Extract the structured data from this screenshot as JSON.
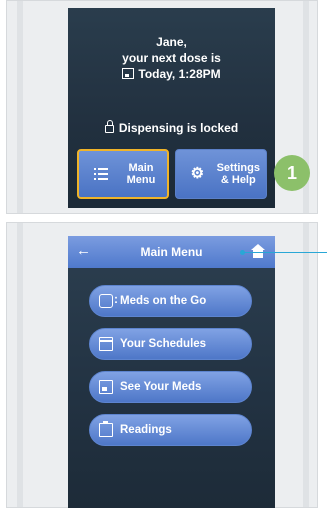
{
  "step1": {
    "greeting_name": "Jane,",
    "next_dose_line": "your next dose is",
    "dose_time": "Today, 1:28PM",
    "lock_status": "Dispensing is locked",
    "main_menu_line1": "Main",
    "main_menu_line2": "Menu",
    "settings_line1": "Settings",
    "settings_line2": "& Help",
    "step_number": "1"
  },
  "step2": {
    "title": "Main Menu",
    "items": [
      {
        "label": "Meds on the Go",
        "icon": "pill-icon"
      },
      {
        "label": "Your Schedules",
        "icon": "calendar-icon"
      },
      {
        "label": "See Your Meds",
        "icon": "med-box-icon"
      },
      {
        "label": "Readings",
        "icon": "clipboard-icon"
      }
    ]
  },
  "colors": {
    "screen_bg": "#223140",
    "button_blue": "#4e77c8",
    "highlight_border": "#f0b429",
    "step_badge": "#8cc06a",
    "pointer_line": "#29a7d6"
  }
}
